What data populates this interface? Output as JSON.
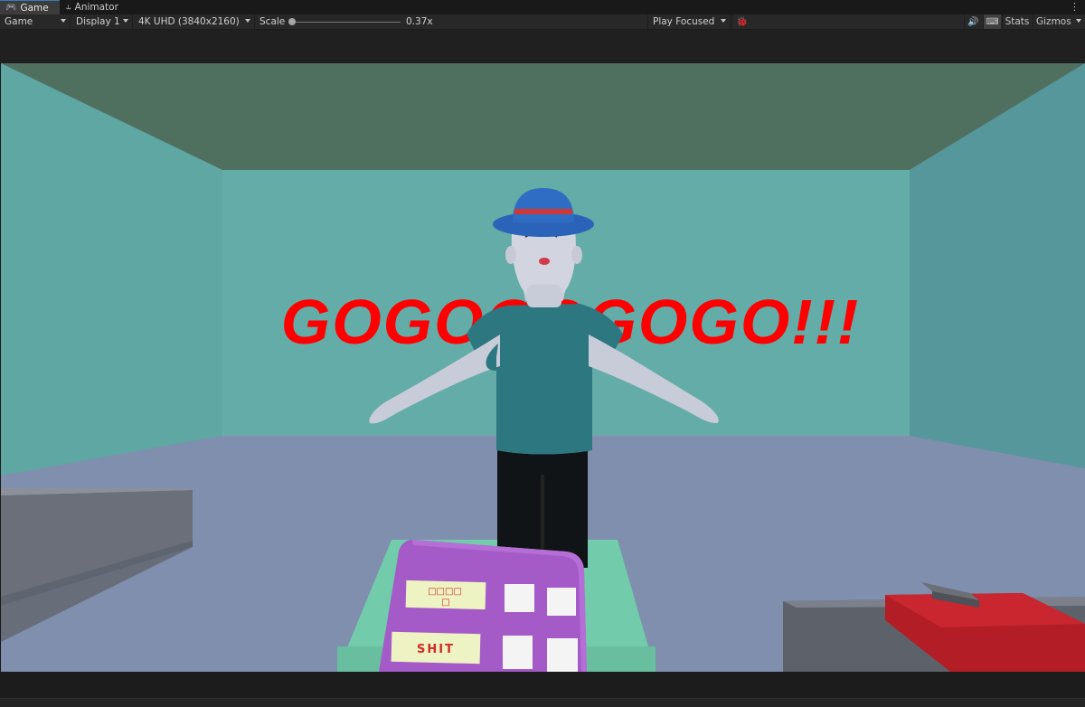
{
  "tabs": [
    {
      "label": "Game",
      "icon": "gamepad-icon",
      "active": true
    },
    {
      "label": "Animator",
      "icon": "animator-icon",
      "active": false
    }
  ],
  "toolbar": {
    "view_mode": "Game",
    "display": "Display 1",
    "resolution": "4K UHD (3840x2160)",
    "scale_label": "Scale",
    "scale_value": "0.37x",
    "scale_fraction": 0.0,
    "play_mode": "Play Focused",
    "stats_label": "Stats",
    "gizmos_label": "Gizmos"
  },
  "scene": {
    "slogan": "GOGOGOGOGO!!!",
    "phone_label": "SHIT",
    "phone_screen_text_1": "□□□□",
    "phone_screen_text_2": "□",
    "colors": {
      "ceiling": "#4f705f",
      "back_wall": "#63aca7",
      "side_wall": "#5aa39e",
      "floor": "#7f8fad",
      "slogan": "#ff0000",
      "shirt": "#2d7781",
      "hat": "#2a63b8",
      "phone": "#a45bc7",
      "table": "#72cbaa",
      "red_block": "#b31d25"
    }
  }
}
